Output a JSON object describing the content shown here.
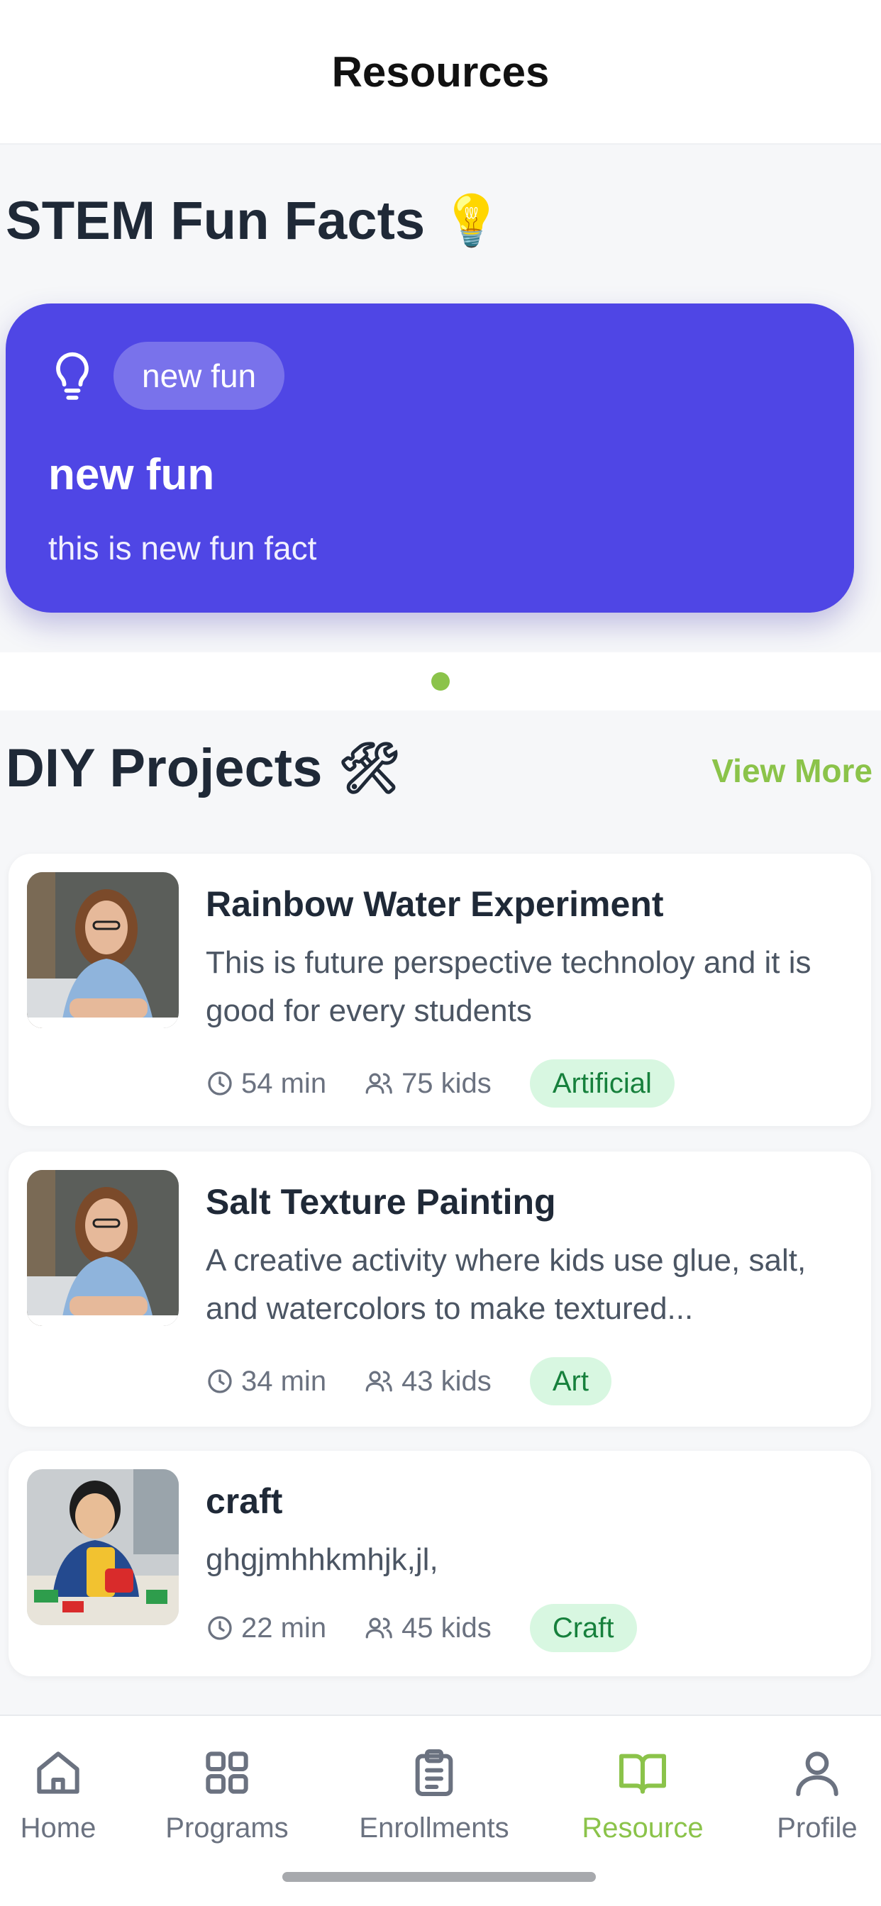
{
  "header": {
    "title": "Resources"
  },
  "fun_facts": {
    "section_title": "STEM Fun Facts",
    "section_icon": "lightbulb-emoji",
    "card": {
      "icon": "lightbulb-icon",
      "pill": "new fun",
      "title": "new fun",
      "text": "this is new fun fact",
      "color": "#4f46e5"
    },
    "pagination_dots": 1
  },
  "diy": {
    "section_title": "DIY Projects",
    "section_icon": "tools-emoji",
    "view_more": "View More",
    "projects": [
      {
        "title": "Rainbow Water Experiment",
        "description": "This is future perspective technoloy and it is good for every students",
        "duration": "54 min",
        "kids": "75 kids",
        "tag": "Artificial"
      },
      {
        "title": "Salt Texture Painting",
        "description": "A creative activity where kids use glue, salt, and watercolors to make textured...",
        "duration": "34 min",
        "kids": "43 kids",
        "tag": "Art"
      },
      {
        "title": "craft",
        "description": "ghgjmhhkmhjk,jl,",
        "duration": "22 min",
        "kids": "45 kids",
        "tag": "Craft"
      }
    ]
  },
  "tabbar": {
    "items": [
      {
        "label": "Home",
        "icon": "home-icon"
      },
      {
        "label": "Programs",
        "icon": "grid-icon"
      },
      {
        "label": "Enrollments",
        "icon": "clipboard-icon"
      },
      {
        "label": "Resource",
        "icon": "book-icon",
        "active": true
      },
      {
        "label": "Profile",
        "icon": "user-icon"
      }
    ],
    "active_color": "#8bc34a"
  }
}
